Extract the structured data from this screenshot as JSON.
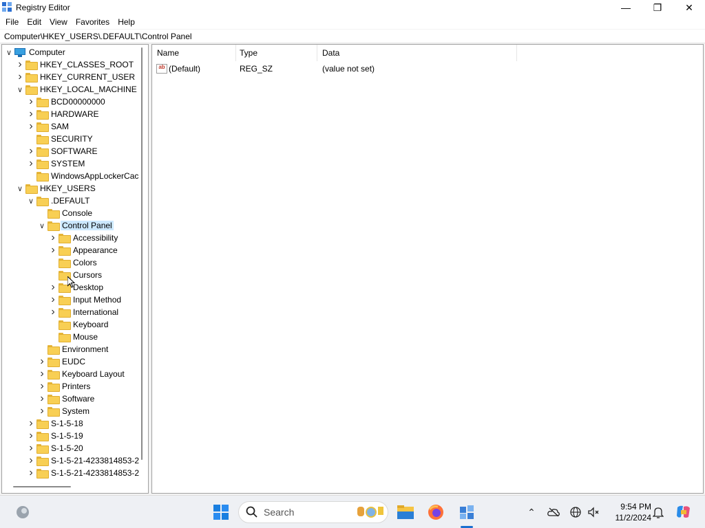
{
  "window": {
    "title": "Registry Editor"
  },
  "menu": [
    "File",
    "Edit",
    "View",
    "Favorites",
    "Help"
  ],
  "address": "Computer\\HKEY_USERS\\.DEFAULT\\Control Panel",
  "tree": [
    {
      "label": "Computer",
      "depth": 0,
      "state": "expanded",
      "icon": "computer-icon"
    },
    {
      "label": "HKEY_CLASSES_ROOT",
      "depth": 1,
      "state": "collapsed"
    },
    {
      "label": "HKEY_CURRENT_USER",
      "depth": 1,
      "state": "collapsed"
    },
    {
      "label": "HKEY_LOCAL_MACHINE",
      "depth": 1,
      "state": "expanded"
    },
    {
      "label": "BCD00000000",
      "depth": 2,
      "state": "collapsed"
    },
    {
      "label": "HARDWARE",
      "depth": 2,
      "state": "collapsed"
    },
    {
      "label": "SAM",
      "depth": 2,
      "state": "collapsed"
    },
    {
      "label": "SECURITY",
      "depth": 2,
      "state": "leaf"
    },
    {
      "label": "SOFTWARE",
      "depth": 2,
      "state": "collapsed"
    },
    {
      "label": "SYSTEM",
      "depth": 2,
      "state": "collapsed"
    },
    {
      "label": "WindowsAppLockerCac",
      "depth": 2,
      "state": "leaf"
    },
    {
      "label": "HKEY_USERS",
      "depth": 1,
      "state": "expanded"
    },
    {
      "label": ".DEFAULT",
      "depth": 2,
      "state": "expanded"
    },
    {
      "label": "Console",
      "depth": 3,
      "state": "leaf"
    },
    {
      "label": "Control Panel",
      "depth": 3,
      "state": "expanded",
      "selected": true
    },
    {
      "label": "Accessibility",
      "depth": 4,
      "state": "collapsed"
    },
    {
      "label": "Appearance",
      "depth": 4,
      "state": "collapsed"
    },
    {
      "label": "Colors",
      "depth": 4,
      "state": "leaf"
    },
    {
      "label": "Cursors",
      "depth": 4,
      "state": "leaf"
    },
    {
      "label": "Desktop",
      "depth": 4,
      "state": "collapsed"
    },
    {
      "label": "Input Method",
      "depth": 4,
      "state": "collapsed"
    },
    {
      "label": "International",
      "depth": 4,
      "state": "collapsed"
    },
    {
      "label": "Keyboard",
      "depth": 4,
      "state": "leaf"
    },
    {
      "label": "Mouse",
      "depth": 4,
      "state": "leaf"
    },
    {
      "label": "Environment",
      "depth": 3,
      "state": "leaf"
    },
    {
      "label": "EUDC",
      "depth": 3,
      "state": "collapsed"
    },
    {
      "label": "Keyboard Layout",
      "depth": 3,
      "state": "collapsed"
    },
    {
      "label": "Printers",
      "depth": 3,
      "state": "collapsed"
    },
    {
      "label": "Software",
      "depth": 3,
      "state": "collapsed"
    },
    {
      "label": "System",
      "depth": 3,
      "state": "collapsed"
    },
    {
      "label": "S-1-5-18",
      "depth": 2,
      "state": "collapsed"
    },
    {
      "label": "S-1-5-19",
      "depth": 2,
      "state": "collapsed"
    },
    {
      "label": "S-1-5-20",
      "depth": 2,
      "state": "collapsed"
    },
    {
      "label": "S-1-5-21-4233814853-2",
      "depth": 2,
      "state": "collapsed"
    },
    {
      "label": "S-1-5-21-4233814853-2",
      "depth": 2,
      "state": "collapsed"
    }
  ],
  "columns": [
    "Name",
    "Type",
    "Data"
  ],
  "values": [
    {
      "name": "(Default)",
      "type": "REG_SZ",
      "data": "(value not set)",
      "icon": "string-value-icon"
    }
  ],
  "taskbar": {
    "search_placeholder": "Search",
    "time": "9:54 PM",
    "date": "11/2/2024"
  }
}
